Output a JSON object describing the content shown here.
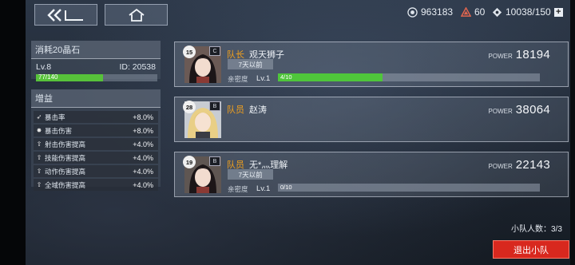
{
  "topbar": {
    "back_icon": "double-chevron-left-icon",
    "home_icon": "home-icon",
    "resources": [
      {
        "icon": "coin-icon",
        "value": "963183"
      },
      {
        "icon": "triangle-crystal-icon",
        "value": "60"
      },
      {
        "icon": "ticket-icon",
        "value": "10038/150"
      }
    ],
    "add_label": "+"
  },
  "squad": {
    "title": "消耗20晶石",
    "level": "Lv.8",
    "id_text": "ID: 20538",
    "exp_text": "77/140",
    "exp_progress": 0.55
  },
  "buffs": {
    "title": "增益",
    "items": [
      {
        "icon": "arrow-icon",
        "name": "暴击率",
        "value": "+8.0%"
      },
      {
        "icon": "burst-icon",
        "name": "暴击伤害",
        "value": "+8.0%"
      },
      {
        "icon": "up-circle-icon",
        "name": "射击伤害提高",
        "value": "+4.0%"
      },
      {
        "icon": "up-circle-icon",
        "name": "技能伤害提高",
        "value": "+4.0%"
      },
      {
        "icon": "up-circle-icon",
        "name": "动作伤害提高",
        "value": "+4.0%"
      },
      {
        "icon": "up-circle-icon",
        "name": "全域伤害提高",
        "value": "+4.0%"
      }
    ]
  },
  "members": [
    {
      "level": "15",
      "rank": "C",
      "role": "队长",
      "name": "观天狮子",
      "time": "7天以前",
      "affinity_label": "亲密度",
      "affinity_level": "Lv.1",
      "affinity_text": "4/10",
      "affinity_progress": 0.4,
      "power_label": "POWER",
      "power": "18194"
    },
    {
      "level": "28",
      "rank": "B",
      "role": "队员",
      "name": "赵涛",
      "power_label": "POWER",
      "power": "38064"
    },
    {
      "level": "19",
      "rank": "B",
      "role": "队员",
      "name": "无*灬理解",
      "time": "7天以前",
      "affinity_label": "亲密度",
      "affinity_level": "Lv.1",
      "affinity_text": "0/10",
      "affinity_progress": 0.0,
      "power_label": "POWER",
      "power": "22143"
    }
  ],
  "footer": {
    "count_text": "小队人数：3/3",
    "leave_label": "退出小队"
  },
  "colors": {
    "accent_orange": "#f2a11d",
    "progress_green": "#4fc63b",
    "leave_red": "#d8281e"
  }
}
